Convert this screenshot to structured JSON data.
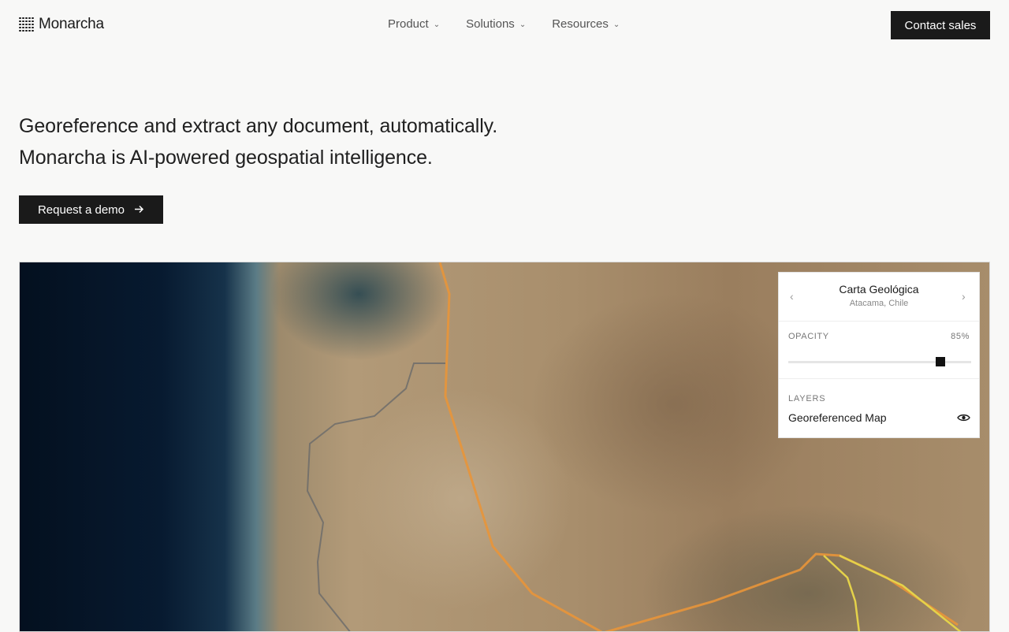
{
  "brand": {
    "name": "Monarcha",
    "logo_icon": "dot-grid-icon"
  },
  "nav": {
    "items": [
      {
        "label": "Product"
      },
      {
        "label": "Solutions"
      },
      {
        "label": "Resources"
      }
    ],
    "contact_label": "Contact sales"
  },
  "hero": {
    "line1": "Georeference and extract any document, automatically.",
    "line2": "Monarcha is AI-powered geospatial intelligence.",
    "cta_label": "Request a demo",
    "cta_icon": "arrow-right-icon"
  },
  "panel": {
    "title": "Carta Geológica",
    "subtitle": "Atacama, Chile",
    "prev_icon": "chevron-left-icon",
    "next_icon": "chevron-right-icon",
    "opacity_label": "OPACITY",
    "opacity_value": "85%",
    "opacity_fraction": 0.85,
    "layers_label": "LAYERS",
    "layer_name": "Georeferenced Map",
    "layer_icon": "eye-icon"
  },
  "colors": {
    "accent": "#1a1a1a",
    "road_orange": "#e8953a",
    "road_yellow": "#e4d24a"
  }
}
